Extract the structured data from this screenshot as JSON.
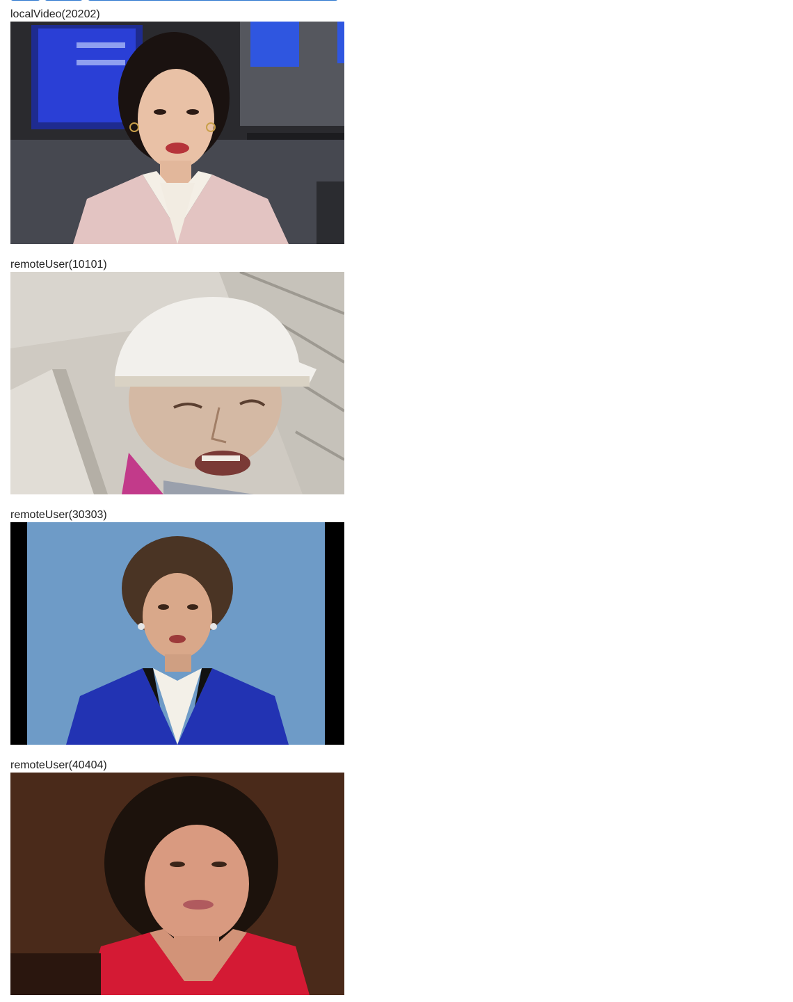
{
  "toolbar": {
    "buttons": [
      "",
      "",
      ""
    ]
  },
  "streams": [
    {
      "label": "localVideo(20202)",
      "video_icon": "video-feed-newscaster"
    },
    {
      "label": "remoteUser(10101)",
      "video_icon": "video-feed-construction-worker"
    },
    {
      "label": "remoteUser(30303)",
      "video_icon": "video-feed-news-anchor"
    },
    {
      "label": "remoteUser(40404)",
      "video_icon": "video-feed-speaker"
    }
  ],
  "colors": {
    "button_blue": "#4a90e2",
    "label_text": "#222222"
  }
}
